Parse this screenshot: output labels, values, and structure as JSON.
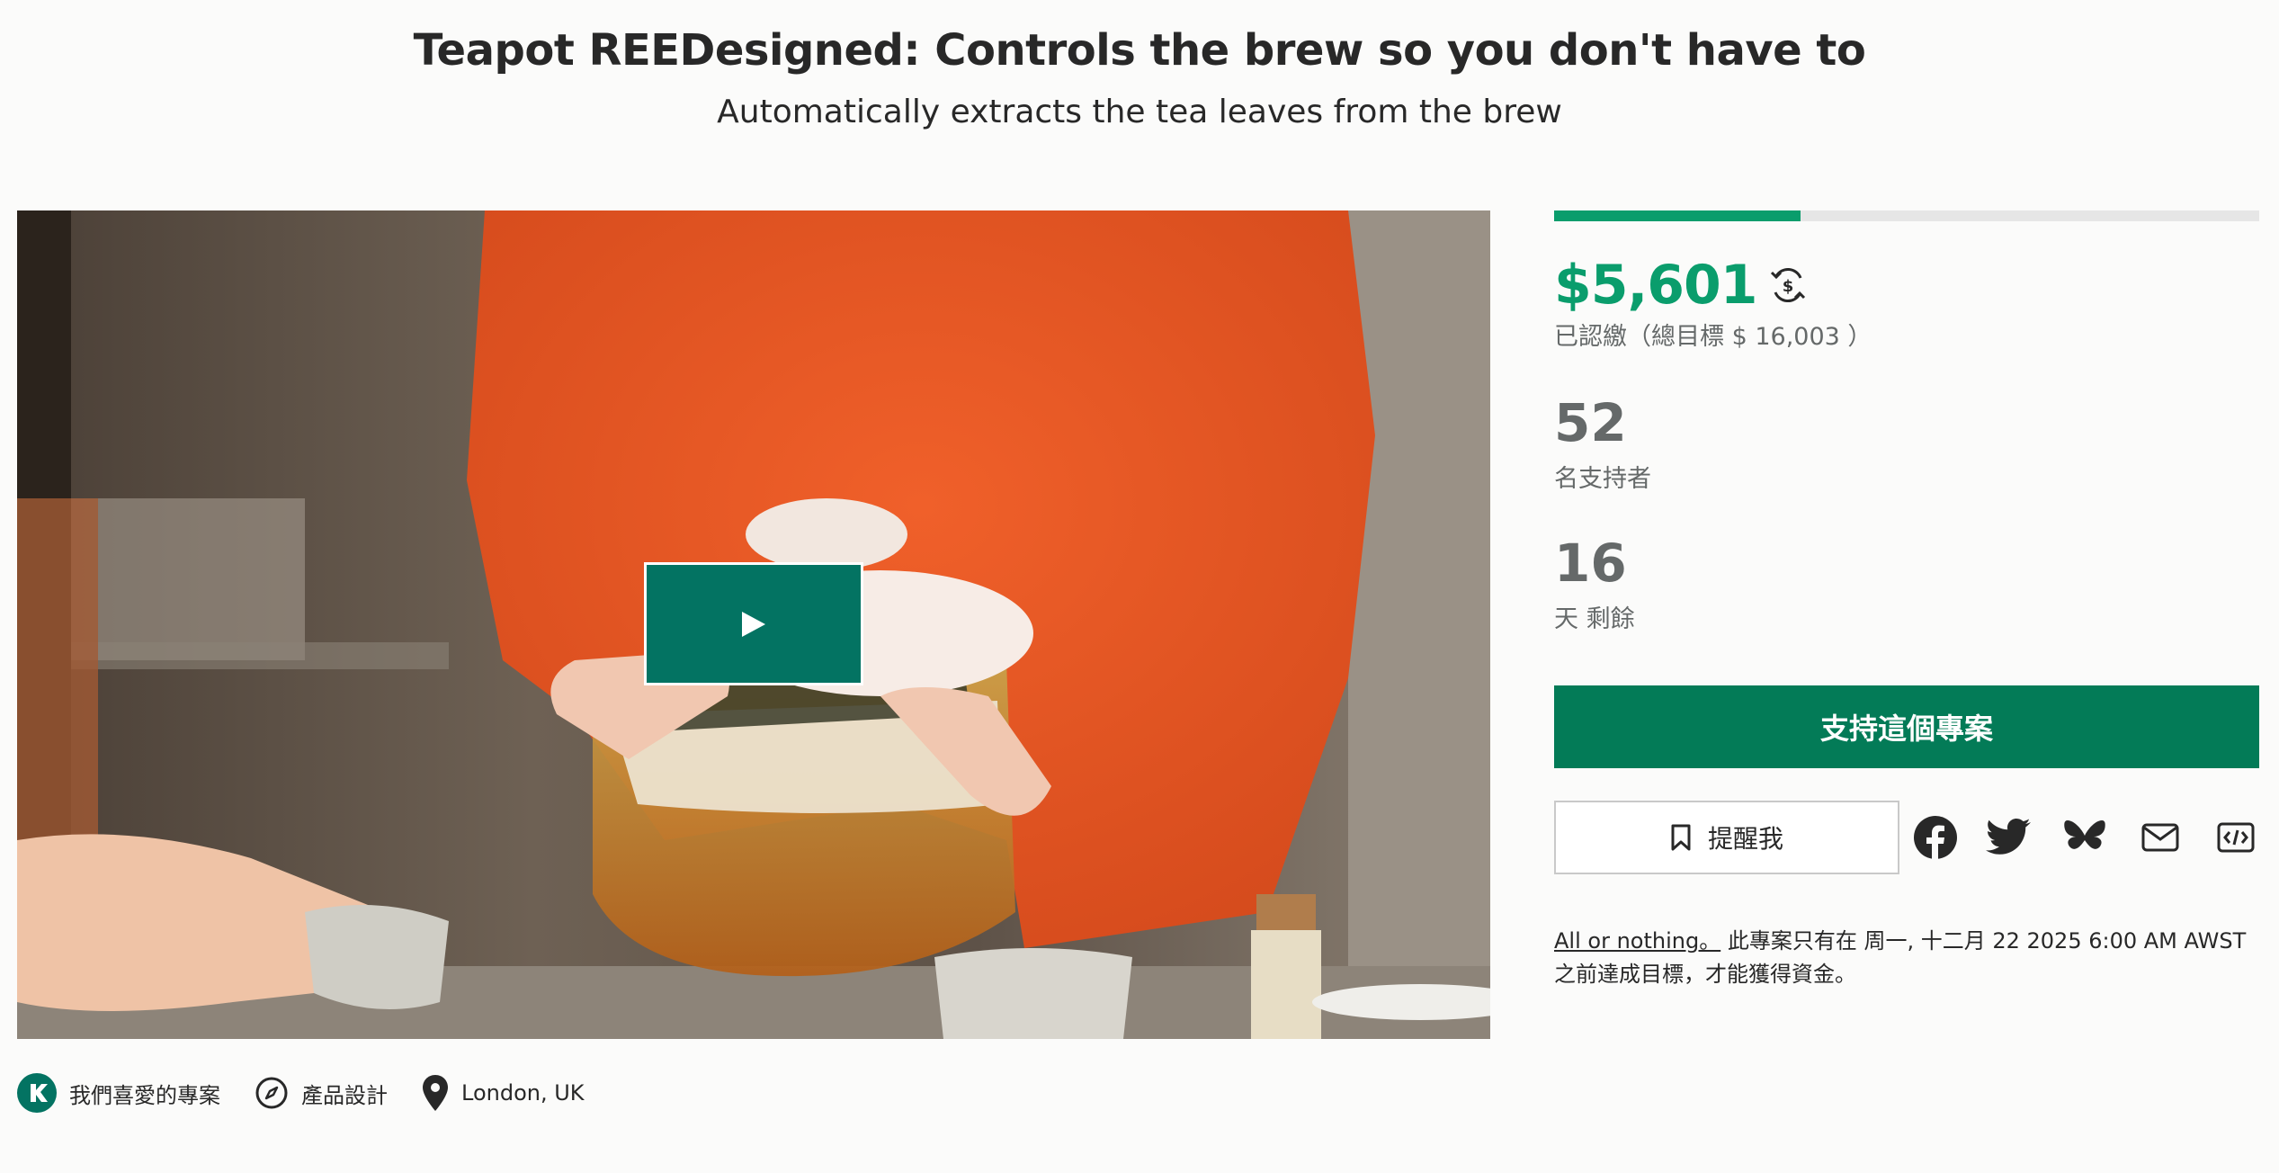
{
  "project": {
    "title": "Teapot REEDesigned: Controls the brew so you don't have to",
    "subtitle": "Automatically extracts the tea leaves from the brew"
  },
  "video": {
    "play_icon": "play-icon"
  },
  "categories": [
    {
      "label": "我們喜愛的專案",
      "icon": "kickstarter-logo-icon"
    },
    {
      "label": "產品設計",
      "icon": "compass-icon"
    },
    {
      "label": "London, UK",
      "icon": "location-pin-icon"
    }
  ],
  "funding": {
    "progress_percent": 35,
    "pledged": "$5,601",
    "currency_icon": "currency-convert-icon",
    "pledged_sub": "已認繳（總目標 $ 16,003 ）",
    "backers_count": "52",
    "backers_label": "名支持者",
    "days_count": "16",
    "days_label": "天 剩餘"
  },
  "actions": {
    "back_label": "支持這個專案",
    "remind_label": "提醒我",
    "remind_icon": "bookmark-icon",
    "share": [
      "facebook-icon",
      "twitter-icon",
      "bluesky-icon",
      "email-icon",
      "embed-icon"
    ]
  },
  "fine_print": {
    "link": "All or nothing。",
    "text": " 此專案只有在 周一, 十二月 22 2025 6:00 AM AWST 之前達成目標，才能獲得資金。"
  },
  "colors": {
    "accent_green": "#0a9d6c",
    "button_green": "#037b57",
    "play_teal": "#037362"
  }
}
